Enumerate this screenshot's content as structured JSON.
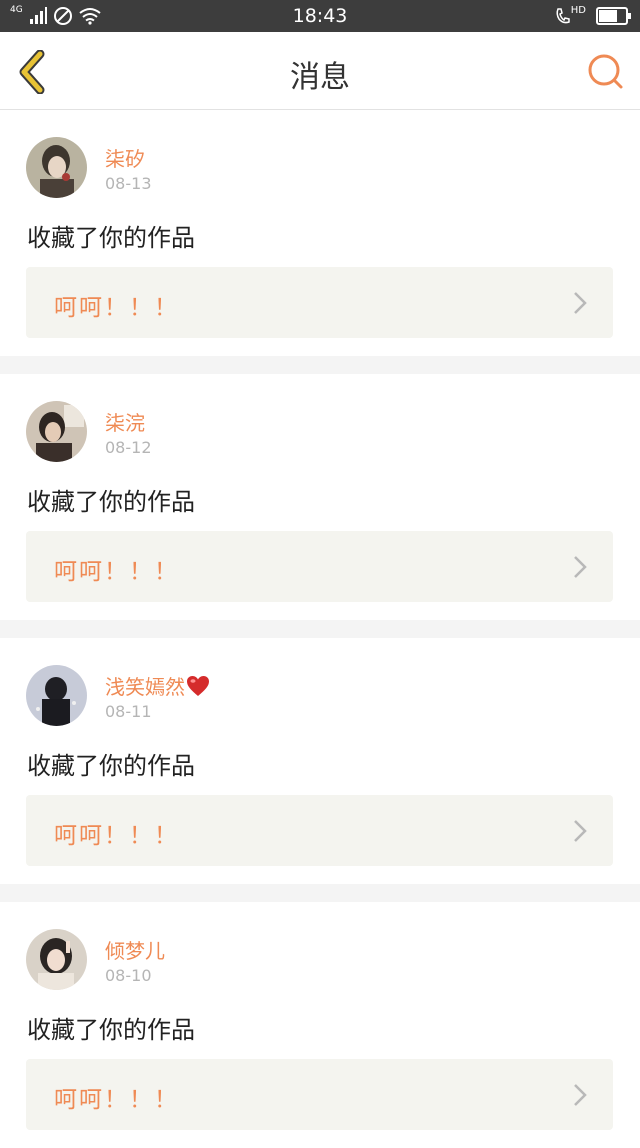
{
  "status_bar": {
    "network": "4G",
    "time": "18:43",
    "call_label": "HD"
  },
  "nav": {
    "title": "消息",
    "back_icon": "chevron-left-icon",
    "search_icon": "search-icon"
  },
  "colors": {
    "accent": "#ef8a54",
    "back_icon": "#e8c335",
    "quote_bg": "#f4f4ef",
    "separator": "#f4f4f4"
  },
  "messages": [
    {
      "name": "柒矽",
      "date": "08-13",
      "action": "收藏了你的作品",
      "quote": "呵呵！！！"
    },
    {
      "name": "柒浣",
      "date": "08-12",
      "action": "收藏了你的作品",
      "quote": "呵呵！！！"
    },
    {
      "name": "浅笑嫣然",
      "date": "08-11",
      "action": "收藏了你的作品",
      "quote": "呵呵！！！"
    },
    {
      "name": "倾梦儿",
      "date": "08-10",
      "action": "收藏了你的作品",
      "quote": "呵呵！！！"
    }
  ]
}
